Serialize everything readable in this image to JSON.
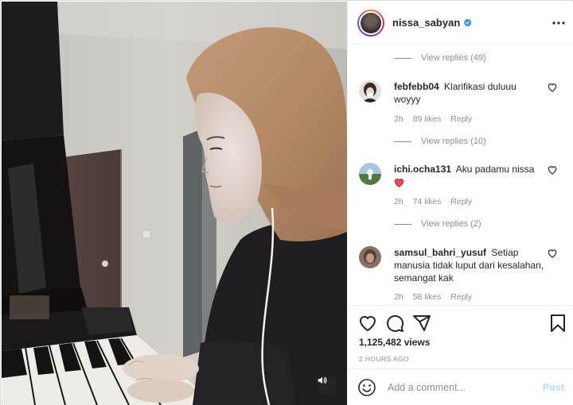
{
  "post": {
    "author": "nissa_sabyan",
    "verified": true
  },
  "comments": {
    "view_replies_top": "View replies (49)",
    "items": [
      {
        "user": "febfebb04",
        "text": "Klarifikasi duluuu woyyy",
        "time": "2h",
        "likes": "89 likes",
        "reply": "Reply",
        "view_replies": "View replies (10)"
      },
      {
        "user": "ichi.ocha131",
        "text": "Aku padamu nissa",
        "emoji": "❤️",
        "time": "2h",
        "likes": "74 likes",
        "reply": "Reply",
        "view_replies": "View replies (2)"
      },
      {
        "user": "samsul_bahri_yusuf",
        "text": "Setiap manusia tidak luput dari kesalahan, semangat kak",
        "time": "2h",
        "likes": "58 likes",
        "reply": "Reply"
      }
    ]
  },
  "stats": {
    "views": "1,125,482 views",
    "time_ago": "2 HOURS AGO"
  },
  "add_comment": {
    "placeholder": "Add a comment...",
    "value": "",
    "post_label": "Post"
  },
  "icons": [
    "more-options-icon",
    "verified-badge-icon",
    "heart-icon",
    "comment-icon",
    "share-icon",
    "bookmark-icon",
    "emoji-icon",
    "volume-icon"
  ],
  "colors": {
    "verified": "#3897f0",
    "post_disabled": "#b2dffc",
    "heart_emoji": "#ed4956",
    "muted_text": "#8e8e8e"
  }
}
